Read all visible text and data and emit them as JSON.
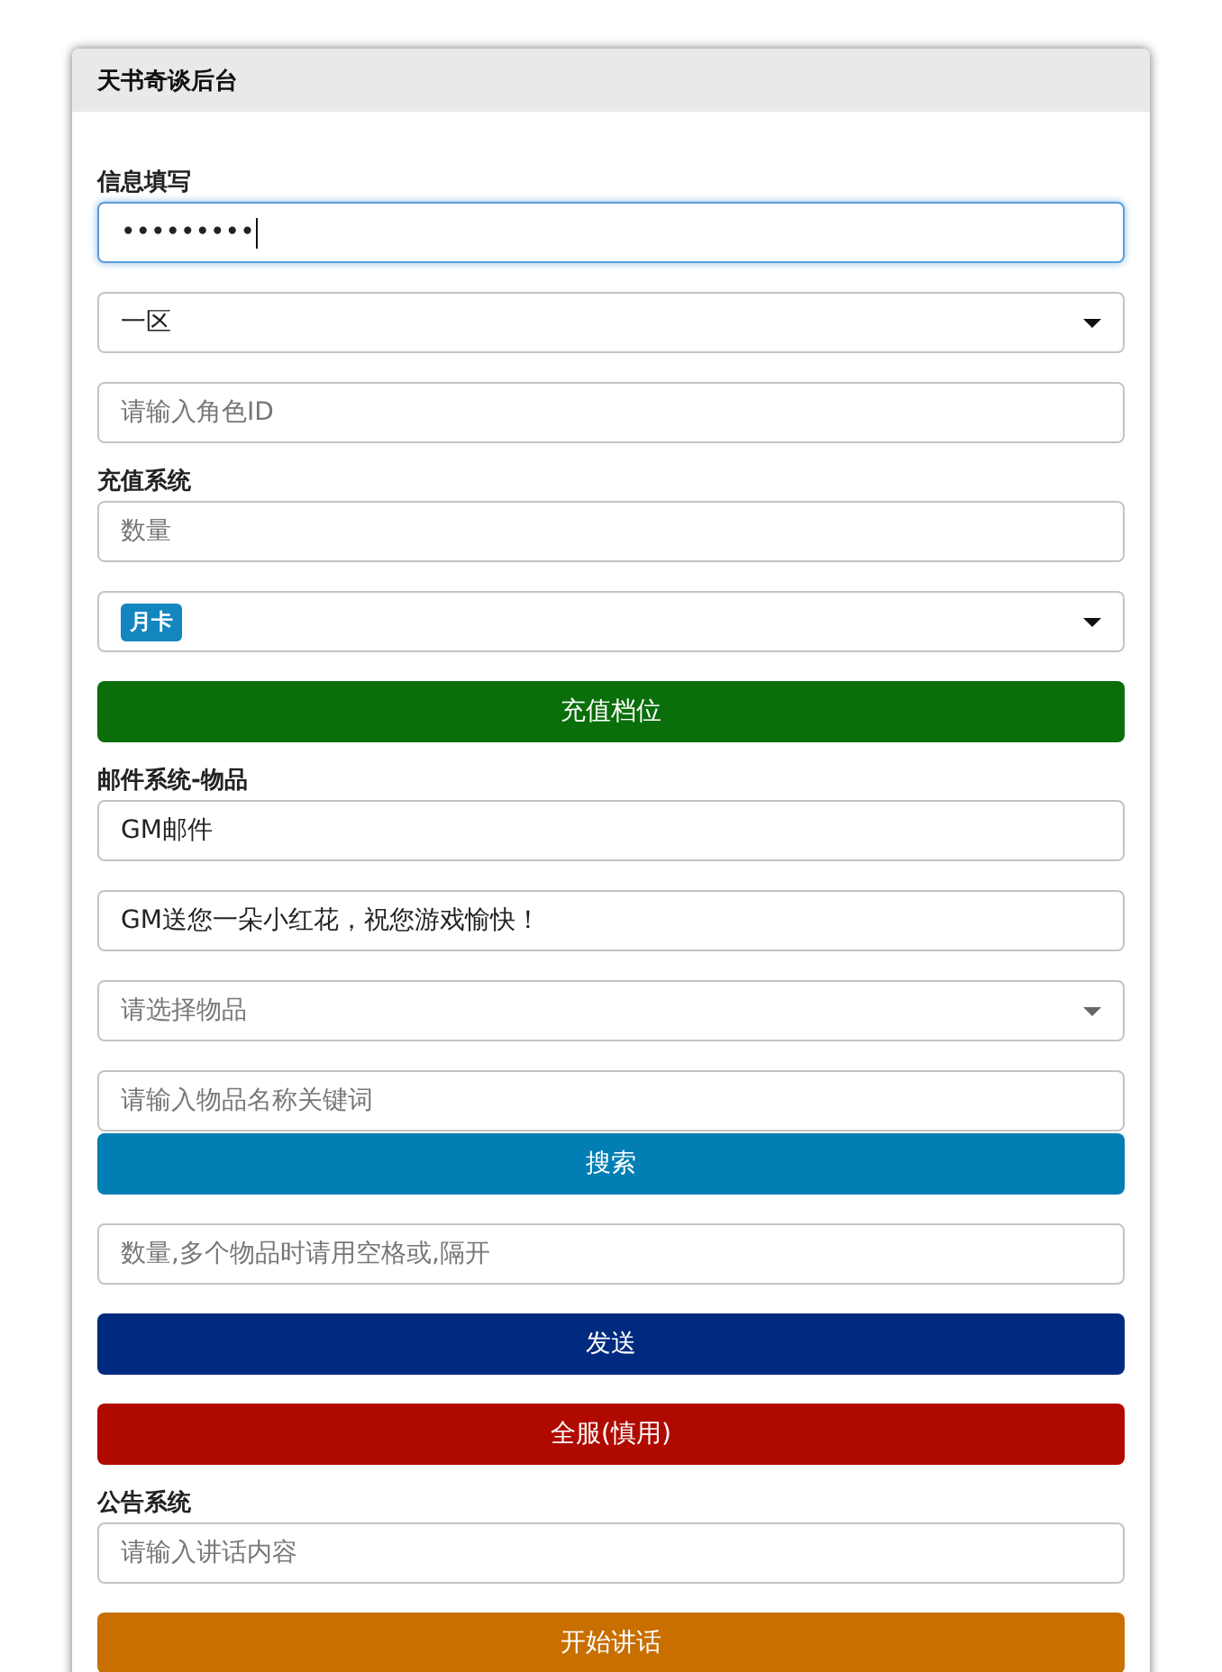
{
  "window": {
    "title": "天书奇谈后台"
  },
  "sections": [
    {
      "label": "信息填写",
      "items": [
        {
          "kind": "input",
          "value": "•••••••••",
          "focused": true
        },
        {
          "kind": "select",
          "value": "一区"
        },
        {
          "kind": "input",
          "placeholder": "请输入角色ID",
          "focused": false
        }
      ]
    },
    {
      "label": "充值系统",
      "items": [
        {
          "kind": "input",
          "placeholder": "数量",
          "focused": false
        },
        {
          "kind": "select",
          "tag": "月卡"
        },
        {
          "kind": "button",
          "label": "充值档位",
          "color": "#0a6e0a"
        }
      ]
    },
    {
      "label": "邮件系统-物品",
      "items": [
        {
          "kind": "input",
          "value": "GM邮件",
          "focused": false
        },
        {
          "kind": "input",
          "value": "GM送您一朵小红花，祝您游戏愉快！",
          "focused": false
        },
        {
          "kind": "select",
          "placeholder": "请选择物品"
        },
        {
          "kind": "search",
          "placeholder": "请输入物品名称关键词",
          "button": {
            "label": "搜索",
            "color": "#017fb4"
          }
        },
        {
          "kind": "input",
          "placeholder": "数量,多个物品时请用空格或,隔开",
          "focused": false
        },
        {
          "kind": "button",
          "label": "发送",
          "color": "#002a80"
        },
        {
          "kind": "button",
          "label": "全服(慎用)",
          "color": "#b00a00"
        }
      ]
    },
    {
      "label": "公告系统",
      "items": [
        {
          "kind": "input",
          "placeholder": "请输入讲话内容",
          "focused": false
        },
        {
          "kind": "button",
          "label": "开始讲话",
          "color": "#c86f00"
        }
      ]
    }
  ]
}
